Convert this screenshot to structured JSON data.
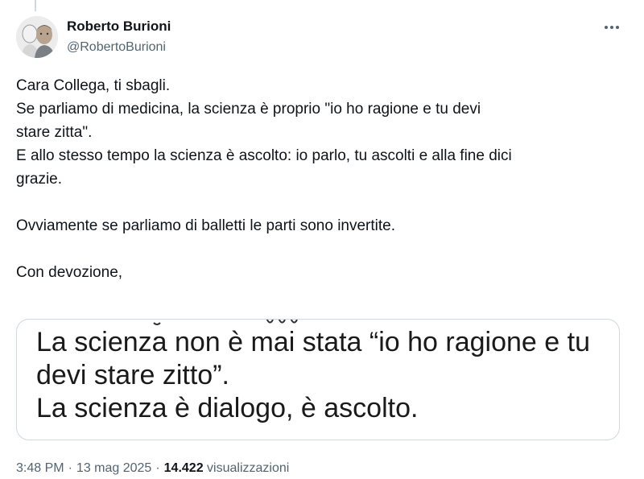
{
  "author": {
    "display_name": "Roberto Burioni",
    "handle": "@RobertoBurioni"
  },
  "tweet": {
    "lines": [
      "Cara Collega, ti sbagli.",
      "Se parliamo di medicina, la scienza è proprio \"io ho ragione e tu devi",
      "stare zitta\".",
      "E allo stesso tempo la scienza è ascolto: io parlo, tu ascolti e alla fine dici",
      "grazie.",
      "",
      "Ovviamente se parliamo di balletti le parti sono invertite.",
      "",
      "Con devozione,"
    ]
  },
  "quote_image": {
    "lines": [
      "La scienza non è mai stata “io ho ragione e tu",
      "devi stare zitto”.",
      "La scienza è dialogo, è ascolto."
    ]
  },
  "meta": {
    "time": "3:48 PM",
    "date": "13 mag 2025",
    "views_count": "14.422",
    "views_label": "visualizzazioni"
  },
  "icons": {
    "more": "more-horizontal-icon"
  },
  "colors": {
    "text_primary": "#0f1419",
    "text_secondary": "#536471",
    "border": "#cfd9de"
  }
}
